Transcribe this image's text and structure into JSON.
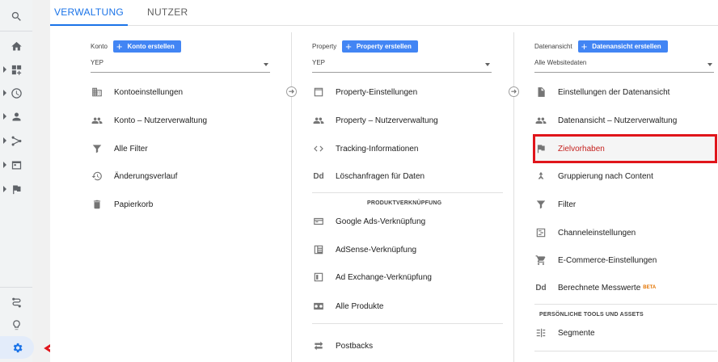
{
  "tabs": [
    {
      "label": "VERWALTUNG"
    },
    {
      "label": "NUTZER"
    }
  ],
  "rail": {
    "items": [
      "search-icon",
      "home-icon",
      "customization-icon",
      "clock-icon",
      "person-icon",
      "acquisition-icon",
      "behavior-icon",
      "flag-icon"
    ],
    "bottom": [
      "route-icon",
      "lightbulb-icon",
      "gear-icon"
    ]
  },
  "account": {
    "label": "Konto",
    "button": "Konto erstellen",
    "selected": "YEP",
    "items": [
      {
        "label": "Kontoeinstellungen",
        "icon": "building-icon"
      },
      {
        "label": "Konto – Nutzerverwaltung",
        "icon": "people-icon"
      },
      {
        "label": "Alle Filter",
        "icon": "filter-icon"
      },
      {
        "label": "Änderungsverlauf",
        "icon": "history-icon"
      },
      {
        "label": "Papierkorb",
        "icon": "trash-icon"
      }
    ]
  },
  "property": {
    "label": "Property",
    "button": "Property erstellen",
    "selected": "YEP",
    "items": [
      {
        "label": "Property-Einstellungen",
        "icon": "window-icon"
      },
      {
        "label": "Property – Nutzerverwaltung",
        "icon": "people-icon"
      },
      {
        "label": "Tracking-Informationen",
        "icon": "code-icon"
      },
      {
        "label": "Löschanfragen für Daten",
        "icon": "dd-icon"
      }
    ],
    "section": "PRODUKTVERKNÜPFUNG",
    "links": [
      {
        "label": "Google Ads-Verknüpfung",
        "icon": "ads-icon"
      },
      {
        "label": "AdSense-Verknüpfung",
        "icon": "adsense-icon"
      },
      {
        "label": "Ad Exchange-Verknüpfung",
        "icon": "adexchange-icon"
      },
      {
        "label": "Alle Produkte",
        "icon": "products-icon"
      }
    ],
    "postbacks": "Postbacks"
  },
  "view": {
    "label": "Datenansicht",
    "button": "Datenansicht erstellen",
    "selected": "Alle Websitedaten",
    "items": [
      {
        "label": "Einstellungen der Datenansicht",
        "icon": "document-icon"
      },
      {
        "label": "Datenansicht – Nutzerverwaltung",
        "icon": "people-icon"
      },
      {
        "label": "Zielvorhaben",
        "icon": "flag-icon"
      },
      {
        "label": "Gruppierung nach Content",
        "icon": "grouping-icon"
      },
      {
        "label": "Filter",
        "icon": "filter-icon"
      },
      {
        "label": "Channeleinstellungen",
        "icon": "channel-icon"
      },
      {
        "label": "E-Commerce-Einstellungen",
        "icon": "cart-icon"
      },
      {
        "label": "Berechnete Messwerte",
        "icon": "dd-icon",
        "badge": "BETA"
      }
    ],
    "section": "PERSÖNLICHE TOOLS UND ASSETS",
    "tools": [
      {
        "label": "Segmente",
        "icon": "segments-icon"
      }
    ]
  },
  "colors": {
    "accent": "#1a73e8",
    "button": "#4285f4",
    "highlight": "#e0151b",
    "goal_text": "#c5221f"
  }
}
